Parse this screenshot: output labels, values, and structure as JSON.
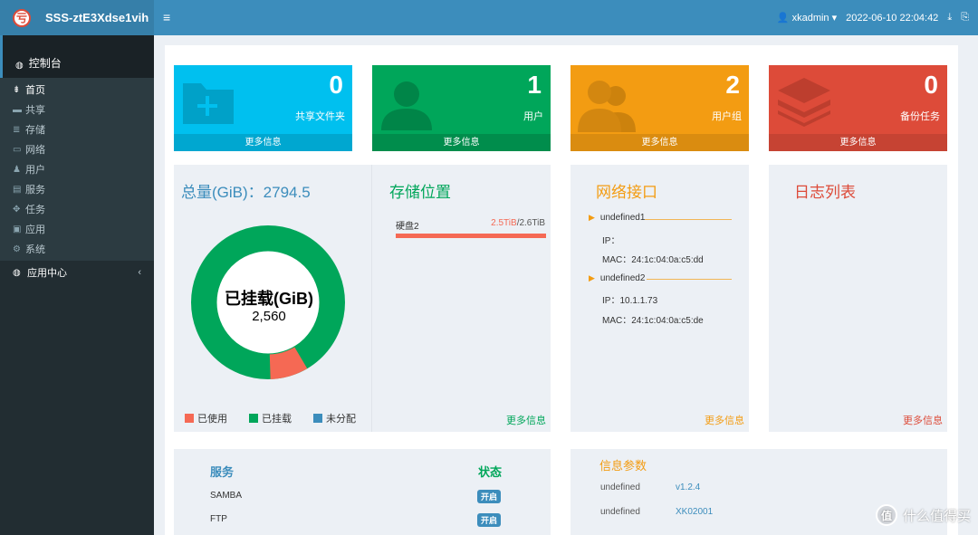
{
  "header": {
    "app_title": "SSS-ztE3Xdse1vih",
    "logo_glyph": "亏",
    "menu_icon": "hamburger-icon",
    "user": "xkadmin",
    "datetime": "2022-06-10 22:04:42"
  },
  "sidebar": {
    "main_label": "控制台",
    "items": [
      {
        "label": "首页",
        "icon": "home-icon"
      },
      {
        "label": "共享",
        "icon": "folder-icon"
      },
      {
        "label": "存储",
        "icon": "database-icon"
      },
      {
        "label": "网络",
        "icon": "laptop-icon"
      },
      {
        "label": "用户",
        "icon": "users-icon"
      },
      {
        "label": "服务",
        "icon": "server-icon"
      },
      {
        "label": "任务",
        "icon": "crosshair-icon"
      },
      {
        "label": "应用",
        "icon": "briefcase-icon"
      },
      {
        "label": "系统",
        "icon": "cogs-icon"
      }
    ],
    "app_center_label": "应用中心"
  },
  "info_boxes": [
    {
      "number": "0",
      "label": "共享文件夹",
      "more": "更多信息",
      "color": "#00c0ef",
      "icon": "folder-plus-icon"
    },
    {
      "number": "1",
      "label": "用户",
      "more": "更多信息",
      "color": "#00a65a",
      "icon": "user-icon"
    },
    {
      "number": "2",
      "label": "用户组",
      "more": "更多信息",
      "color": "#f39c12",
      "icon": "users-icon"
    },
    {
      "number": "0",
      "label": "备份任务",
      "more": "更多信息",
      "color": "#dd4b39",
      "icon": "layers-icon"
    }
  ],
  "capacity": {
    "title": "总量(GiB)：2794.5",
    "center_label": "已挂载(GiB)",
    "center_value": "2,560",
    "legend": [
      {
        "label": "已使用",
        "color": "#f56954"
      },
      {
        "label": "已挂载",
        "color": "#00a65a"
      },
      {
        "label": "未分配",
        "color": "#3c8dbc"
      }
    ],
    "used_fraction": 0.08,
    "mounted_fraction": 0.92
  },
  "storage": {
    "title": "存储位置",
    "disk_name": "硬盘2",
    "disk_used": "2.5TiB",
    "disk_total": "/2.6TiB",
    "more": "更多信息"
  },
  "network": {
    "title": "网络接口",
    "interfaces": [
      {
        "name": "undefined1",
        "ip": "IP：",
        "mac": "MAC：24:1c:04:0a:c5:dd"
      },
      {
        "name": "undefined2",
        "ip": "IP：10.1.1.73",
        "mac": "MAC：24:1c:04:0a:c5:de"
      }
    ],
    "more": "更多信息"
  },
  "logs": {
    "title": "日志列表",
    "more": "更多信息"
  },
  "services": {
    "col_service": "服务",
    "col_status": "状态",
    "rows": [
      {
        "name": "SAMBA",
        "status": "开启"
      },
      {
        "name": "FTP",
        "status": "开启"
      }
    ]
  },
  "info_params": {
    "title": "信息参数",
    "rows": [
      {
        "key": "undefined",
        "value": "v1.2.4"
      },
      {
        "key": "undefined",
        "value": "XK02001"
      }
    ]
  },
  "watermark": {
    "glyph": "值",
    "text": "什么值得买"
  }
}
